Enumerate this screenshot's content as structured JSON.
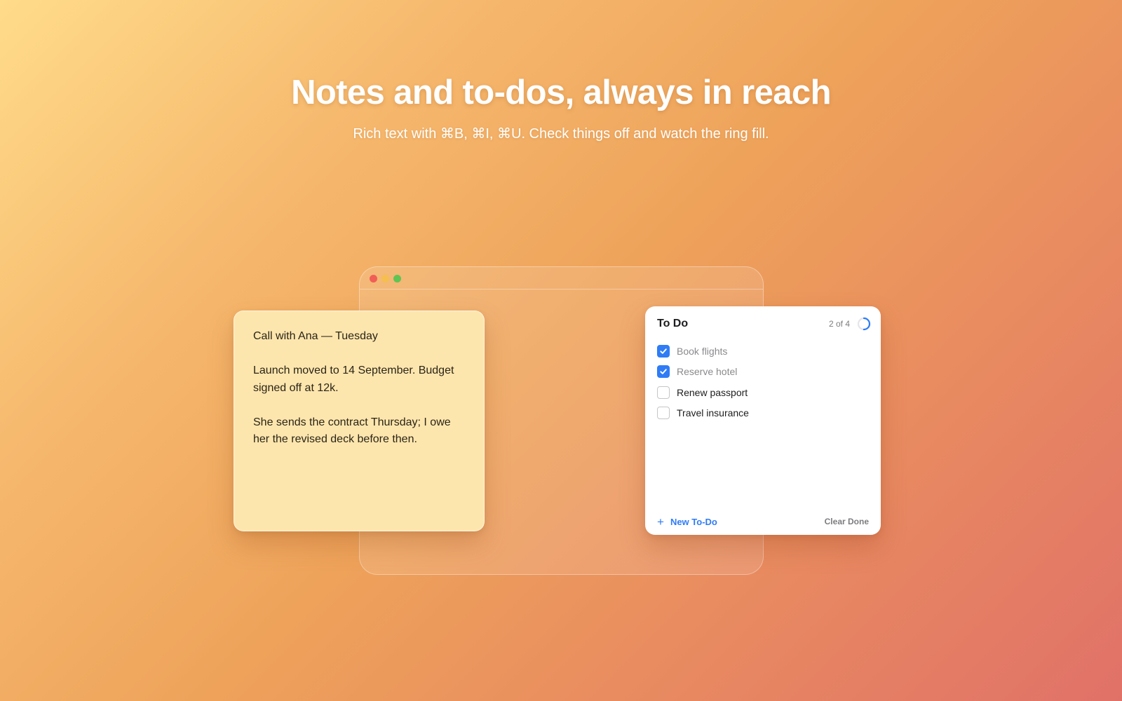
{
  "hero": {
    "title": "Notes and to-dos, always in reach",
    "subtitle": "Rich text with ⌘B, ⌘I, ⌘U. Check things off and watch the ring fill."
  },
  "note": {
    "paragraphs": [
      "Call with Ana — Tuesday",
      "Launch moved to 14 September. Budget signed off at 12k.",
      "She sends the contract Thursday; I owe her the revised deck before then."
    ]
  },
  "todo": {
    "title": "To Do",
    "count_label": "2 of 4",
    "progress_fraction": 0.5,
    "accent_color": "#2f7cf6",
    "items": [
      {
        "label": "Book flights",
        "done": true
      },
      {
        "label": "Reserve hotel",
        "done": true
      },
      {
        "label": "Renew passport",
        "done": false
      },
      {
        "label": "Travel insurance",
        "done": false
      }
    ],
    "new_label": "New To-Do",
    "new_icon": "plus-icon",
    "clear_label": "Clear Done"
  }
}
